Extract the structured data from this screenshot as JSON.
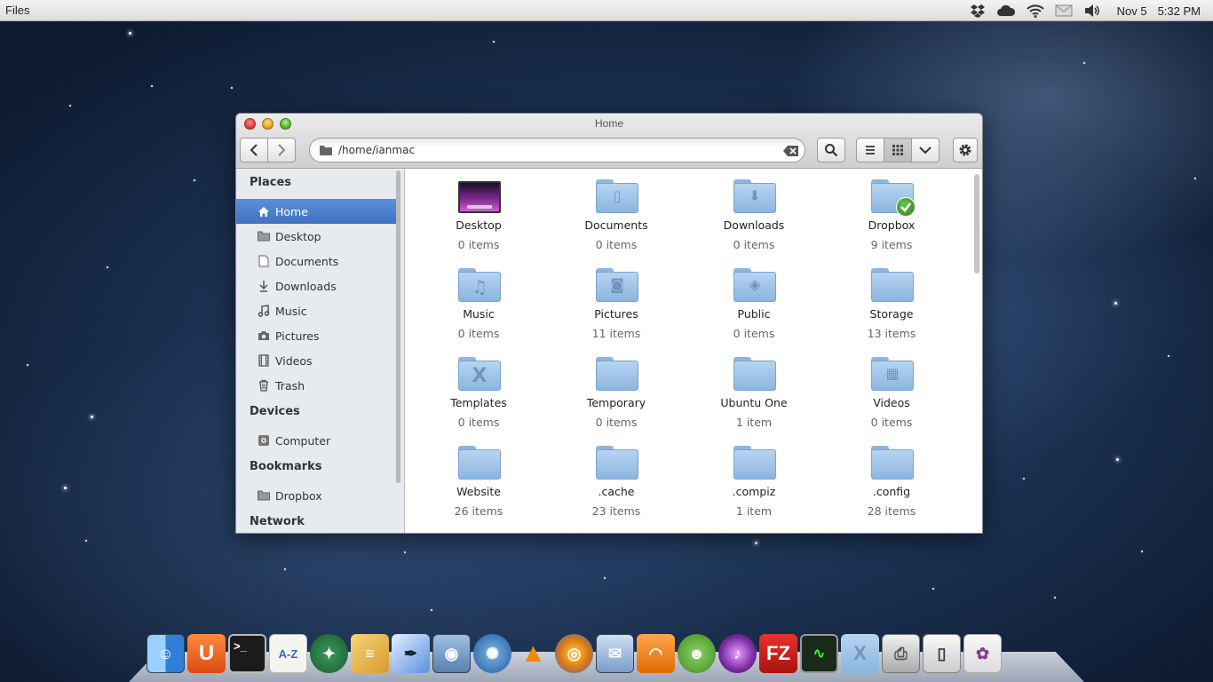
{
  "panel": {
    "app_name": "Files",
    "date": "Nov  5",
    "time": "5:32 PM",
    "tray_icons": [
      "dropbox-icon",
      "cloud-icon",
      "wifi-icon",
      "mail-icon",
      "volume-icon"
    ]
  },
  "window": {
    "title": "Home",
    "location_path": "/home/ianmac"
  },
  "sidebar": {
    "places_header": "Places",
    "places": [
      {
        "label": "Home",
        "icon": "home-icon",
        "active": true
      },
      {
        "label": "Desktop",
        "icon": "folder-icon"
      },
      {
        "label": "Documents",
        "icon": "document-icon"
      },
      {
        "label": "Downloads",
        "icon": "download-icon"
      },
      {
        "label": "Music",
        "icon": "music-icon"
      },
      {
        "label": "Pictures",
        "icon": "camera-icon"
      },
      {
        "label": "Videos",
        "icon": "film-icon"
      },
      {
        "label": "Trash",
        "icon": "trash-icon"
      }
    ],
    "devices_header": "Devices",
    "devices": [
      {
        "label": "Computer",
        "icon": "drive-icon"
      }
    ],
    "bookmarks_header": "Bookmarks",
    "bookmarks": [
      {
        "label": "Dropbox",
        "icon": "folder-icon"
      }
    ],
    "network_header": "Network"
  },
  "files": [
    {
      "name": "Desktop",
      "count": "0 items",
      "icon": "desktop-icon"
    },
    {
      "name": "Documents",
      "count": "0 items",
      "icon": "documents-folder-icon"
    },
    {
      "name": "Downloads",
      "count": "0 items",
      "icon": "downloads-folder-icon"
    },
    {
      "name": "Dropbox",
      "count": "9 items",
      "icon": "dropbox-folder-icon"
    },
    {
      "name": "Music",
      "count": "0 items",
      "icon": "music-folder-icon"
    },
    {
      "name": "Pictures",
      "count": "11 items",
      "icon": "pictures-folder-icon"
    },
    {
      "name": "Public",
      "count": "0 items",
      "icon": "public-folder-icon"
    },
    {
      "name": "Storage",
      "count": "13 items",
      "icon": "folder-icon"
    },
    {
      "name": "Templates",
      "count": "0 items",
      "icon": "templates-folder-icon"
    },
    {
      "name": "Temporary",
      "count": "0 items",
      "icon": "folder-icon"
    },
    {
      "name": "Ubuntu One",
      "count": "1 item",
      "icon": "folder-icon"
    },
    {
      "name": "Videos",
      "count": "0 items",
      "icon": "videos-folder-icon"
    },
    {
      "name": "Website",
      "count": "26 items",
      "icon": "folder-icon"
    },
    {
      "name": ".cache",
      "count": "23 items",
      "icon": "folder-icon"
    },
    {
      "name": ".compiz",
      "count": "1 item",
      "icon": "folder-icon"
    },
    {
      "name": ".config",
      "count": "28 items",
      "icon": "folder-icon"
    }
  ],
  "dock": {
    "apps": [
      "finder-icon",
      "ubuntu-one-icon",
      "terminal-icon",
      "text-editor-icon",
      "game-icon",
      "archive-icon",
      "quill-icon",
      "preview-icon",
      "shotwell-icon",
      "vlc-icon",
      "browser-icon",
      "mail-icon",
      "rss-icon",
      "pidgin-icon",
      "music-icon",
      "filezilla-icon",
      "activity-monitor-icon",
      "utilities-folder-icon",
      "printer-icon",
      "files-icon",
      "settings-icon"
    ]
  },
  "colors": {
    "sidebar_active": "#4a7fcc",
    "folder": "#9cc0e6"
  }
}
